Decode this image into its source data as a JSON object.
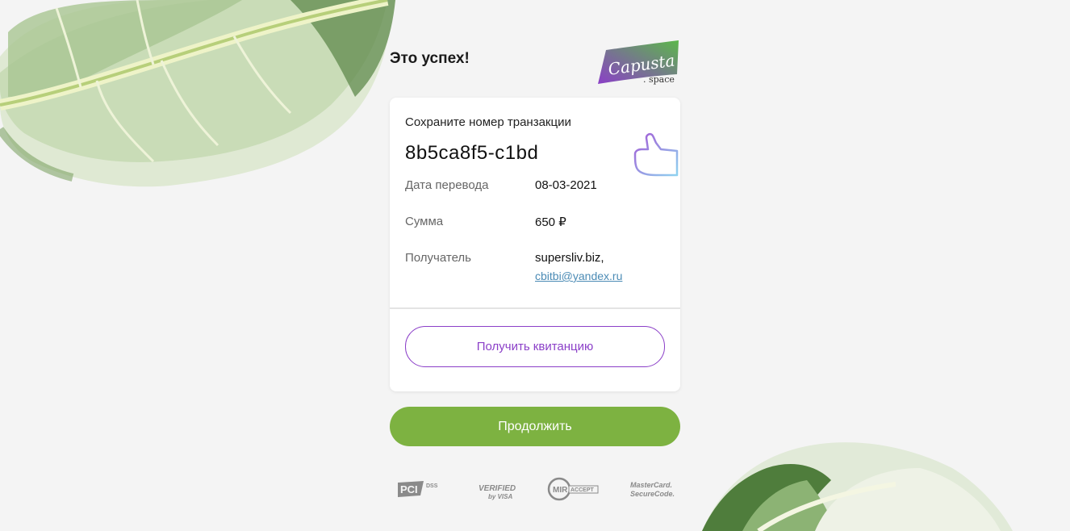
{
  "header": {
    "title": "Это успех!"
  },
  "logo": {
    "name": "Capusta",
    "suffix": ". space"
  },
  "card": {
    "save_label": "Сохраните номер транзакции",
    "transaction_id": "8b5ca8f5-c1bd",
    "rows": [
      {
        "label": "Дата перевода",
        "value": "08-03-2021"
      },
      {
        "label": "Сумма",
        "value": "650 ₽"
      },
      {
        "label": "Получатель",
        "value": "supersliv.biz,",
        "link": "cbitbi@yandex.ru"
      }
    ],
    "receipt_button": "Получить квитанцию"
  },
  "continue_button": "Продолжить",
  "badges": {
    "pci": "PCI DSS",
    "visa_top": "VERIFIED",
    "visa_bottom": "by VISA",
    "mir": "MIR ACCEPT",
    "mastercard_top": "MasterCard.",
    "mastercard_bottom": "SecureCode."
  },
  "colors": {
    "accent_purple": "#8b3fc8",
    "accent_green": "#7db241",
    "link": "#4b8bb5"
  }
}
